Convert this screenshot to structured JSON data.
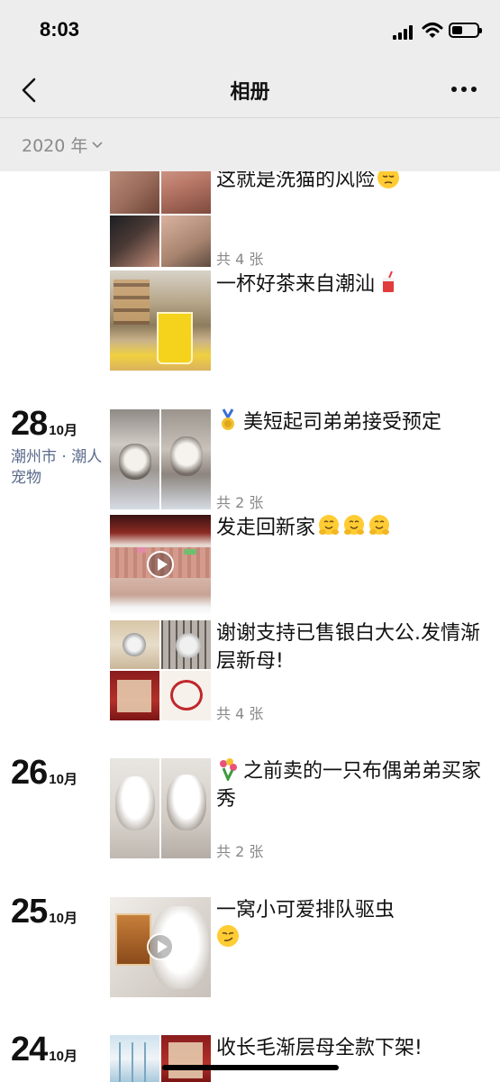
{
  "status": {
    "time": "8:03"
  },
  "nav": {
    "title": "相册"
  },
  "filter": {
    "year": "2020 年"
  },
  "posts": {
    "p1": {
      "caption": "这就是洗猫的风险",
      "count": "共 4 张"
    },
    "p2": {
      "caption": "一杯好茶来自潮汕"
    },
    "d28": {
      "day": "28",
      "month": "10月",
      "location": "潮州市 · 潮人宠物"
    },
    "p3": {
      "caption": "美短起司弟弟接受预定",
      "count": "共 2 张"
    },
    "p4": {
      "caption": "发走回新家"
    },
    "p5": {
      "caption": "谢谢支持已售银白大公.发情渐层新母!",
      "count": "共 4 张"
    },
    "d26": {
      "day": "26",
      "month": "10月"
    },
    "p6": {
      "caption": "之前卖的一只布偶弟弟买家秀",
      "count": "共 2 张"
    },
    "d25": {
      "day": "25",
      "month": "10月"
    },
    "p7": {
      "caption": "一窝小可爱排队驱虫"
    },
    "d24": {
      "day": "24",
      "month": "10月"
    },
    "p8": {
      "caption": "收长毛渐层母全款下架!"
    }
  },
  "icons": {
    "back": "chevron-left-icon",
    "more": "more-dots-icon",
    "year_dropdown": "chevron-down-icon",
    "play": "play-icon",
    "emoji_pensive": "pensive-face-emoji",
    "emoji_drink": "cup-with-straw-emoji",
    "emoji_medal": "medal-emoji",
    "emoji_hug": "hugging-face-emoji",
    "emoji_flowers": "bouquet-emoji",
    "emoji_smirk": "smirking-face-emoji"
  },
  "colors": {
    "header_bg": "#ededed",
    "location": "#5b6b8c",
    "muted": "#888888",
    "text": "#111111"
  }
}
